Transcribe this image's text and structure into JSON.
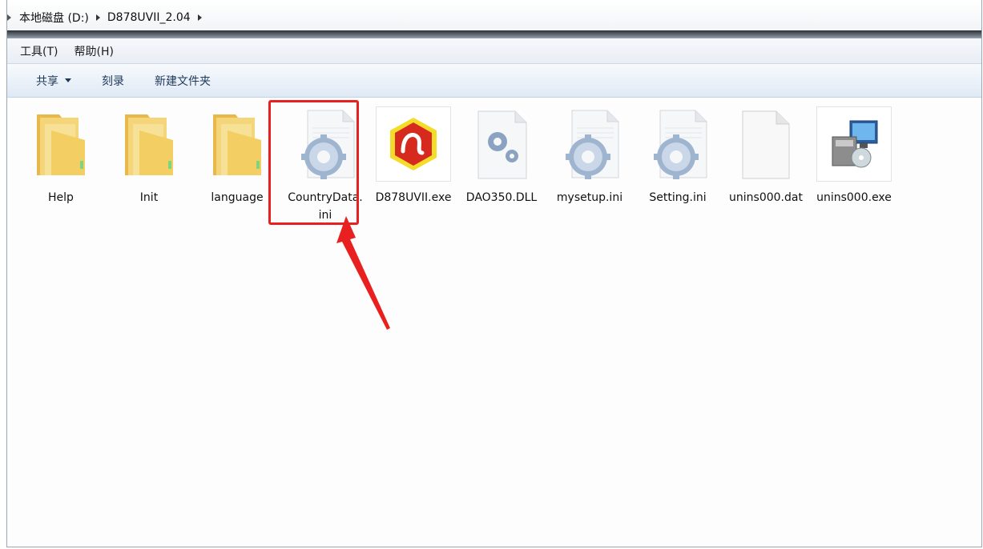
{
  "address": {
    "segments": [
      "本地磁盘 (D:)",
      "D878UVII_2.04"
    ]
  },
  "menu": {
    "items": [
      "工具(T)",
      "帮助(H)"
    ]
  },
  "toolbar": {
    "share_label": "共享",
    "burn_label": "刻录",
    "new_folder_label": "新建文件夹"
  },
  "files": [
    {
      "name": "Help",
      "icon": "folder-icon"
    },
    {
      "name": "Init",
      "icon": "folder-icon"
    },
    {
      "name": "language",
      "icon": "folder-icon"
    },
    {
      "name": "CountryData.ini",
      "icon": "ini-settings-icon"
    },
    {
      "name": "D878UVII.exe",
      "icon": "app-exe-icon"
    },
    {
      "name": "DAO350.DLL",
      "icon": "dll-gear-icon"
    },
    {
      "name": "mysetup.ini",
      "icon": "ini-settings-icon"
    },
    {
      "name": "Setting.ini",
      "icon": "ini-settings-icon"
    },
    {
      "name": "unins000.dat",
      "icon": "blank-file-icon"
    },
    {
      "name": "unins000.exe",
      "icon": "installer-exe-icon"
    }
  ],
  "annotation": {
    "highlight_color": "#e8201f",
    "highlighted_file": "CountryData.ini"
  },
  "colors": {
    "toolbar_text": "#1e395b",
    "folder": "#f2cf6b"
  }
}
